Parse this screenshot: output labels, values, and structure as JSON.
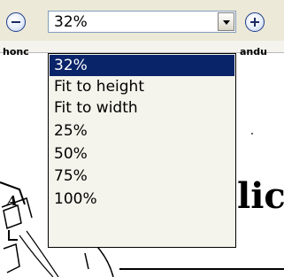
{
  "toolbar": {
    "zoom_value": "32%"
  },
  "dropdown": {
    "options": [
      "32%",
      "Fit to height",
      "Fit to width",
      "25%",
      "50%",
      "75%",
      "100%"
    ],
    "selected_index": 0
  },
  "document": {
    "fragment_left": "honc",
    "fragment_right": "andu",
    "fragment_lic": "lic",
    "fragment_a": "A"
  }
}
